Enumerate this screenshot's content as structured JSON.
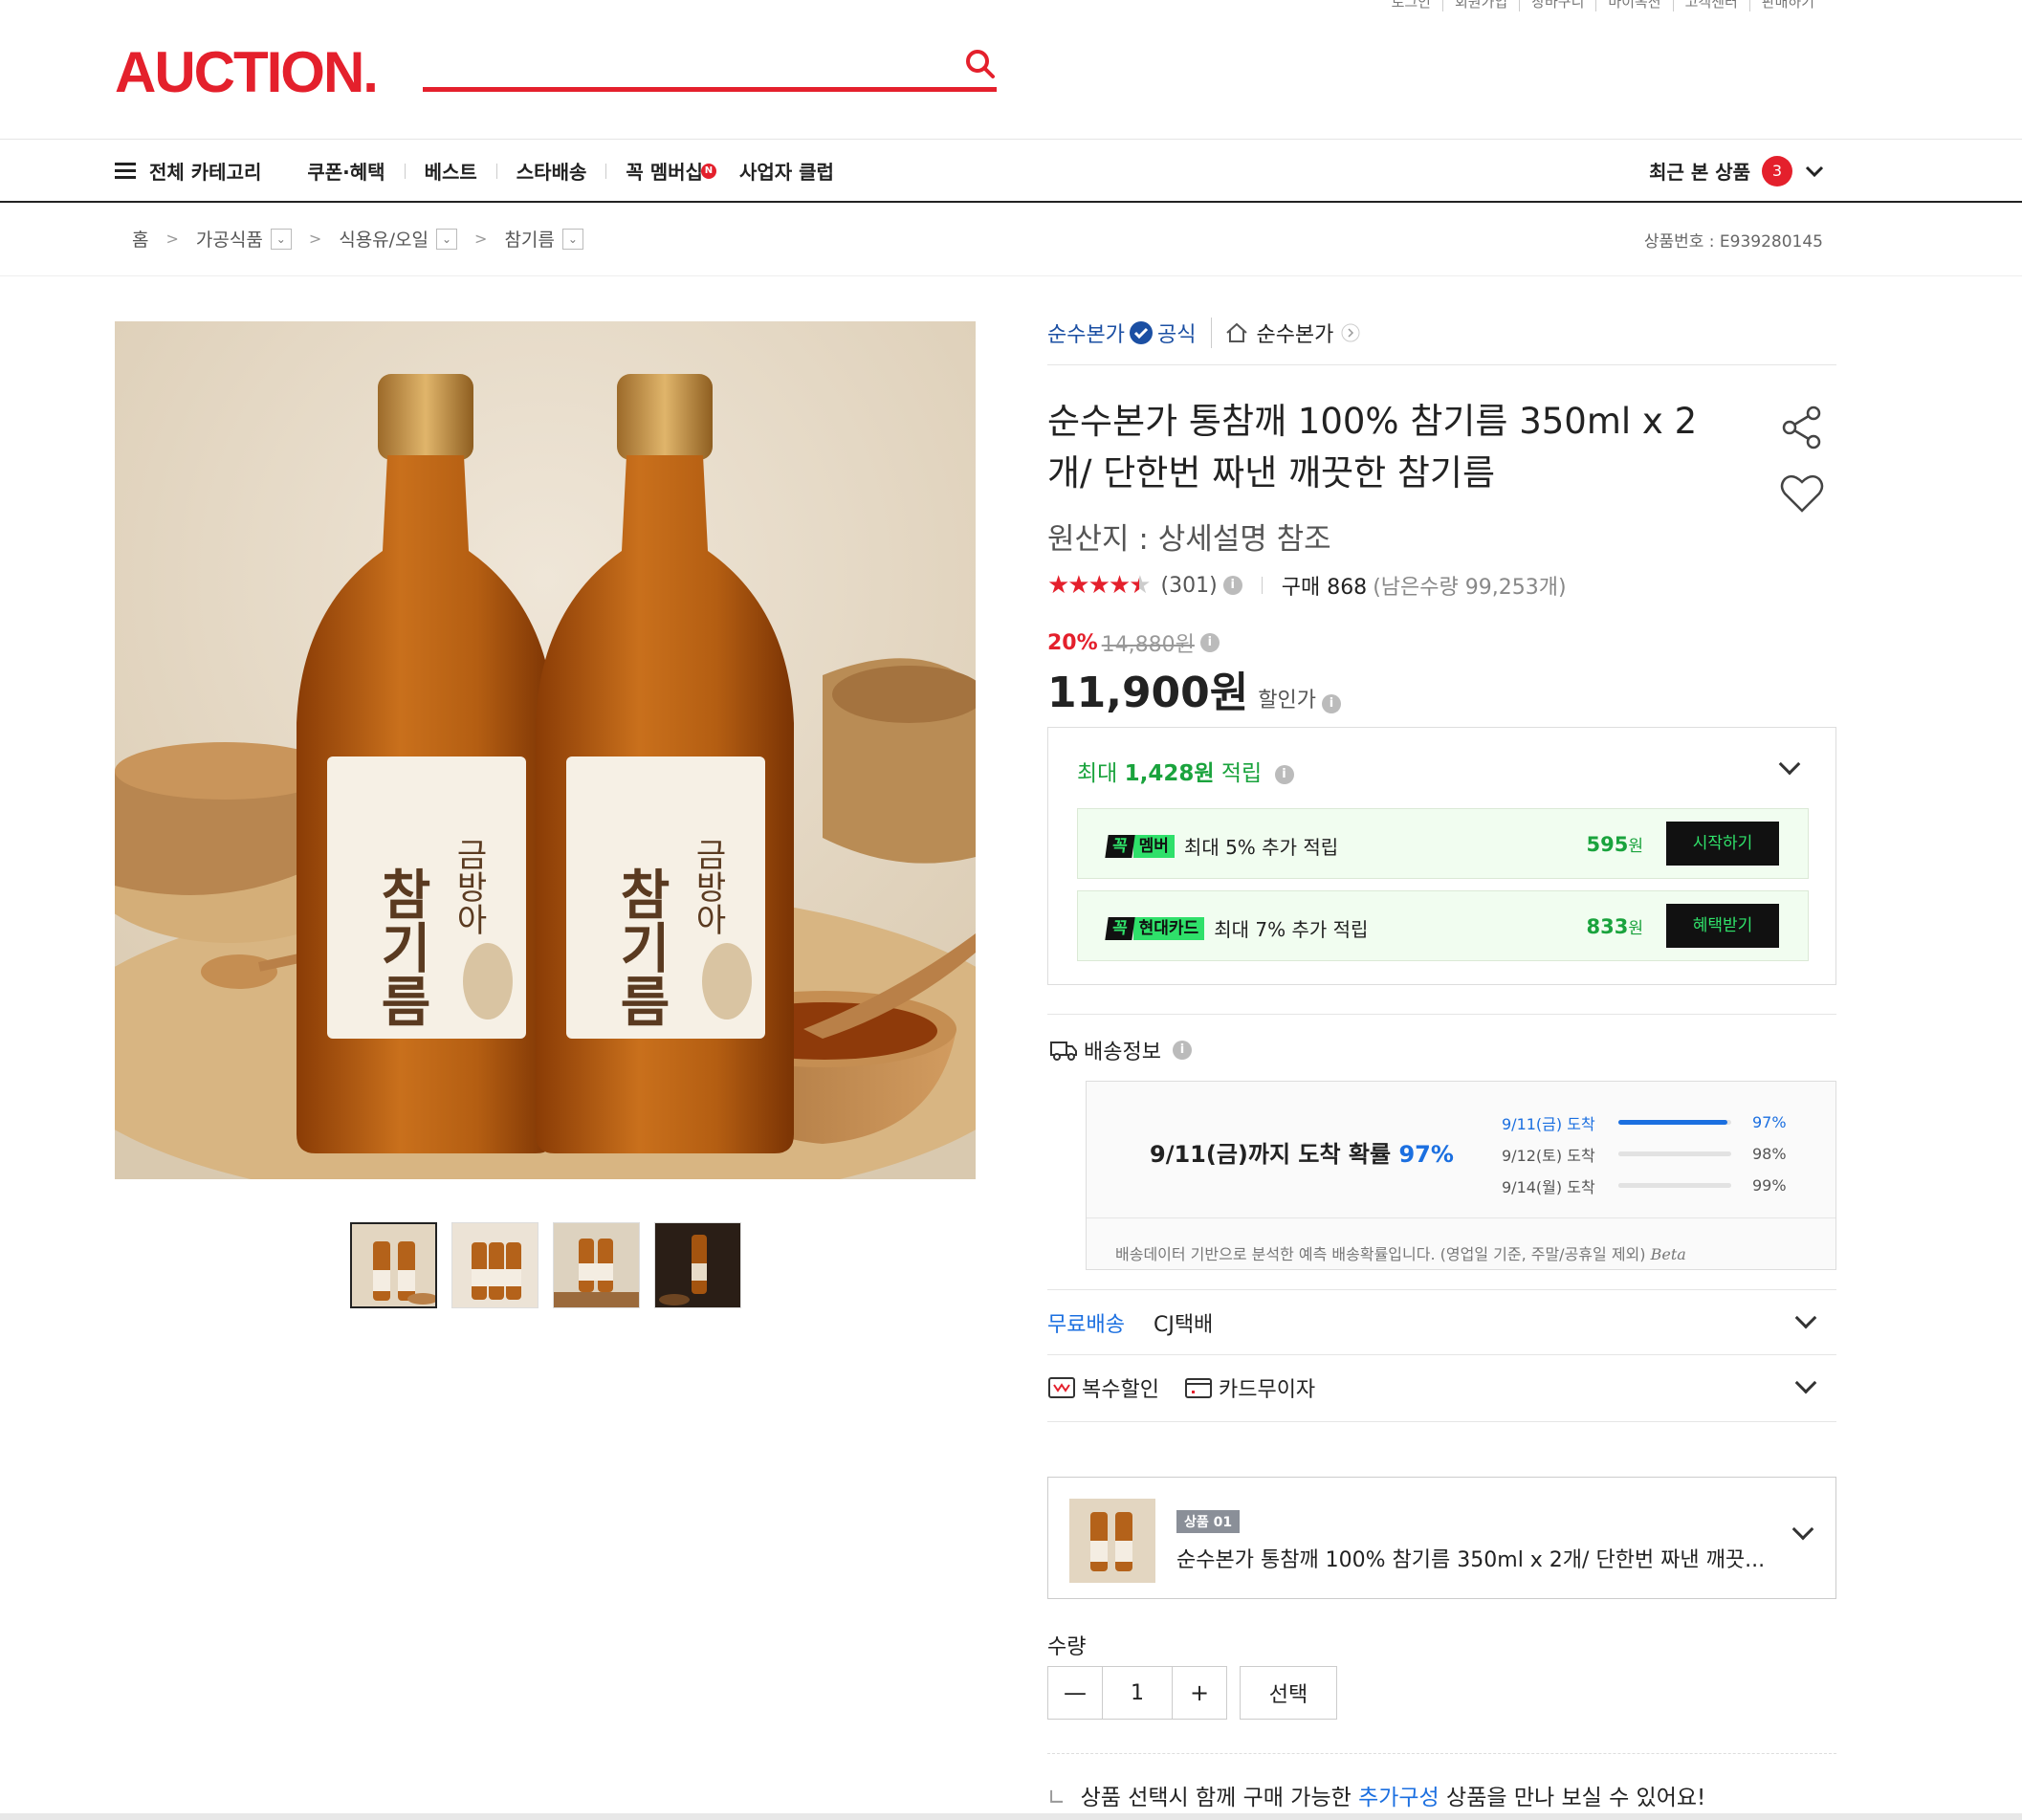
{
  "top_links": [
    "로그인",
    "회원가입",
    "장바구니",
    "마이옥션",
    "고객센터",
    "판매하기"
  ],
  "header": {
    "logo": "AUCTION.",
    "search_placeholder": ""
  },
  "nav": {
    "all_category": "전체 카테고리",
    "items": [
      "쿠폰·혜택",
      "베스트",
      "스타배송",
      "꼭 멤버십",
      "사업자 클럽"
    ],
    "membership_badge": "N",
    "recent_label": "최근 본 상품",
    "recent_count": "3"
  },
  "breadcrumb": {
    "home": "홈",
    "items": [
      "가공식품",
      "식용유/오일",
      "참기름"
    ],
    "product_no": "상품번호 : E939280145"
  },
  "product": {
    "seller": "순수본가",
    "official": "공식",
    "store": "순수본가",
    "title": "순수본가 통참깨 100% 참기름 350ml x 2개/ 단한번 짜낸 깨끗한 참기름",
    "origin": "원산지 : 상세설명 참조",
    "rating_value": 4.5,
    "review_count": "(301)",
    "purchase": "구매 868",
    "stock": "(남은수량 99,253개)",
    "discount_pct": "20%",
    "original_price": "14,880원",
    "price": "11,900원",
    "price_label": "할인가",
    "label_text_big": "참기름",
    "label_text_brand": "금방아"
  },
  "reward": {
    "prefix": "최대",
    "amount": "1,428원",
    "suffix": "적립",
    "rows": [
      {
        "tag_k": "꼭",
        "tag_t": "멤버",
        "desc": "최대 5% 추가 적립",
        "amount": "595",
        "unit": "원",
        "button": "시작하기"
      },
      {
        "tag_k": "꼭",
        "tag_t": "현대카드",
        "desc": "최대 7% 추가 적립",
        "amount": "833",
        "unit": "원",
        "button": "혜택받기"
      }
    ]
  },
  "shipping": {
    "title": "배송정보",
    "main_prefix": "9/11(금)까지 도착 확률",
    "main_pct": "97%",
    "rows": [
      {
        "date": "9/11(금) 도착",
        "pct": "97%",
        "fill": 0.97
      },
      {
        "date": "9/12(토) 도착",
        "pct": "98%",
        "fill": 0.98
      },
      {
        "date": "9/14(월) 도착",
        "pct": "99%",
        "fill": 0.99
      }
    ],
    "note": "배송데이터 기반으로 분석한 예측 배송확률입니다. (영업일 기준, 주말/공휴일 제외)",
    "beta": "Beta",
    "free": "무료배송",
    "carrier": "CJ택배",
    "multi_discount": "복수할인",
    "card_interest": "카드무이자"
  },
  "option": {
    "label": "상품 01",
    "name": "순수본가 통참깨 100% 참기름 350ml x 2개/ 단한번 짜낸 깨끗..."
  },
  "quantity": {
    "label": "수량",
    "value": "1",
    "select": "선택"
  },
  "addon": {
    "before": "상품 선택시 함께 구매 가능한",
    "link": "추가구성",
    "after": "상품을 만나 보실 수 있어요!"
  },
  "colors": {
    "brand": "#e4202c",
    "blue": "#1b6fe0",
    "green": "#1aa33d"
  }
}
